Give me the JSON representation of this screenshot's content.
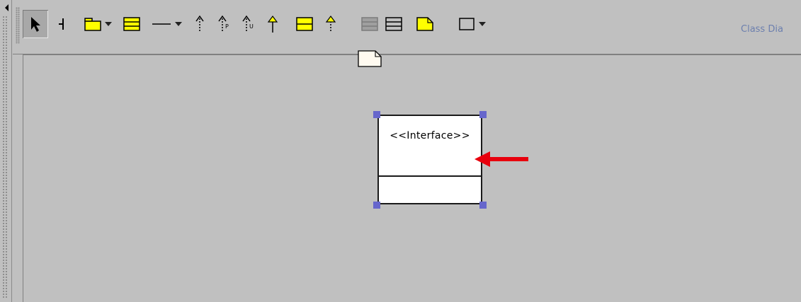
{
  "toolbar": {
    "tools": [
      {
        "name": "select-tool",
        "icon": "select-arrow-icon",
        "selected": true
      },
      {
        "name": "broom-tool",
        "icon": "broom-icon"
      },
      {
        "name": "package-tool",
        "icon": "package-icon",
        "dropdown": true
      },
      {
        "name": "class-tool",
        "icon": "class-icon"
      },
      {
        "name": "association-tool",
        "icon": "association-line-icon",
        "dropdown": true
      },
      {
        "name": "dependency-tool",
        "icon": "dependency-arrow-icon"
      },
      {
        "name": "permission-tool",
        "icon": "permission-arrow-icon"
      },
      {
        "name": "usage-tool",
        "icon": "usage-arrow-icon"
      },
      {
        "name": "generalization-tool",
        "icon": "generalization-arrow-icon"
      },
      {
        "name": "interface-tool",
        "icon": "interface-icon"
      },
      {
        "name": "realization-tool",
        "icon": "realization-arrow-icon"
      },
      {
        "name": "attribute-tool",
        "icon": "add-attribute-icon"
      },
      {
        "name": "operation-tool",
        "icon": "add-operation-icon"
      },
      {
        "name": "note-tool",
        "icon": "note-icon"
      },
      {
        "name": "rectangle-tool",
        "icon": "rectangle-icon",
        "dropdown": true
      }
    ],
    "diagram_tab_label": "Class Dia"
  },
  "canvas": {
    "element": {
      "stereotype": "<<Interface>>",
      "kind": "interface"
    },
    "annotation_arrow_color": "#e8000d"
  },
  "colors": {
    "yellow": "#ffff00",
    "handle": "#6666cc",
    "background": "#c0c0c0",
    "tab_text": "#6c7fae"
  }
}
